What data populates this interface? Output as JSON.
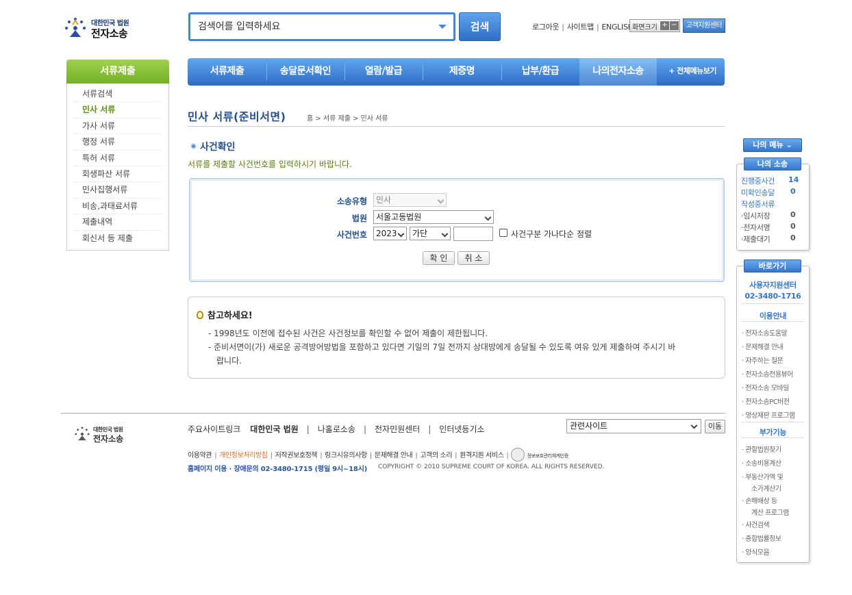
{
  "header": {
    "logo_small": "대한민국 법원",
    "logo_big": "전자소송",
    "search_placeholder": "검색어를 입력하세요",
    "search_button": "검색",
    "util_links": [
      "로그아웃",
      "사이트맵",
      "ENGLISH"
    ],
    "font_size_label": "화면크기",
    "font_plus": "+",
    "font_minus": "−",
    "support_button": "고객지원센터"
  },
  "sidebar": {
    "title": "서류제출",
    "items": [
      "서류검색",
      "민사 서류",
      "가사 서류",
      "행정 서류",
      "특허 서류",
      "회생파산 서류",
      "민사집행서류",
      "비송,과태료서류",
      "제출내역",
      "회신서 등 제출"
    ],
    "active_index": 1
  },
  "gnb": {
    "menus": [
      "서류제출",
      "송달문서확인",
      "열람/발급",
      "제증명",
      "납부/환급",
      "나의전자소송"
    ],
    "active_index": 5,
    "all_menu": "+ 전체메뉴보기"
  },
  "page": {
    "title": "민사 서류(준비서면)",
    "breadcrumb": "홈 > 서류 제출 > 민사 서류",
    "section_title": "사건확인",
    "section_desc": "서류를 제출할 사건번호를 입력하시기 바랍니다."
  },
  "form": {
    "type_label": "소송유형",
    "type_value": "민사",
    "court_label": "법원",
    "court_value": "서울고등법원",
    "case_label": "사건번호",
    "year_value": "2023",
    "mark_value": "가단",
    "number_value": "",
    "sort_checkbox_label": "사건구분 가나다순 정렬",
    "confirm_button": "확 인",
    "cancel_button": "취 소"
  },
  "notice": {
    "title": "참고하세요!",
    "lines": [
      "- 1998년도 이전에 접수된 사건은 사건정보를 확인할 수 없어 제출이 제한됩니다.",
      "- 준비서면이(가) 새로운 공격방어방법을 포함하고 있다면 기일의 7일 전까지 상대방에게 송달될 수 있도록 여유 있게 제출하여 주시기 바",
      "랍니다."
    ]
  },
  "quick": {
    "my_menu": "나의 메뉴 ⌄",
    "my_case_title": "나의 소송",
    "ongoing_label": "진행중사건",
    "ongoing_count": "14",
    "unconfirmed_label": "미확인송달",
    "unconfirmed_count": "0",
    "drafting_label": "작성중서류",
    "temp_label": "·임시저장",
    "temp_count": "0",
    "sign_label": "·전자서명",
    "sign_count": "0",
    "wait_label": "·제출대기",
    "wait_count": "0",
    "shortcut_title": "바로가기",
    "support_center": "사용자지원센터",
    "support_phone": "02-3480-1716",
    "guide_title": "이용안내",
    "guide_links": [
      "· 전자소송도움말",
      "· 문제해결 안내",
      "· 자주하는 질문",
      "· 전자소송전용뷰어",
      "· 전자소송 모바일",
      "· 전자소송PC버전",
      "· 영상재판 프로그램"
    ],
    "extra_title": "부가기능",
    "extra_links": [
      "· 관할법원찾기",
      "· 소송비용계산",
      "· 부동산가액 및",
      "소가계산기",
      "· 손해배상 등",
      "계산 프로그램",
      "· 사건검색",
      "· 종합법률정보",
      "· 양식모음"
    ]
  },
  "footer": {
    "logo_small": "대한민국 법원",
    "logo_big": "전자소송",
    "sites_label": "주요사이트링크",
    "sites": [
      "대한민국 법원",
      "나홀로소송",
      "전자민원센터",
      "인터넷등기소"
    ],
    "related_select": "관련사이트",
    "move_button": "이동",
    "policy_links": [
      "이용약관",
      "개인정보처리방침",
      "저작권보호정책",
      "링크시유의사항",
      "문제해결 안내",
      "고객의 소리",
      "원격지원 서비스"
    ],
    "cert_label": "정보보호관리체계인증",
    "contact": "홈페이지 이용 · 장애문의  02-3480-1715  (평일 9시~18시)",
    "copyright": "COPYRIGHT © 2010 SUPREME COURT OF KOREA. ALL RIGHTS RESERVED."
  }
}
